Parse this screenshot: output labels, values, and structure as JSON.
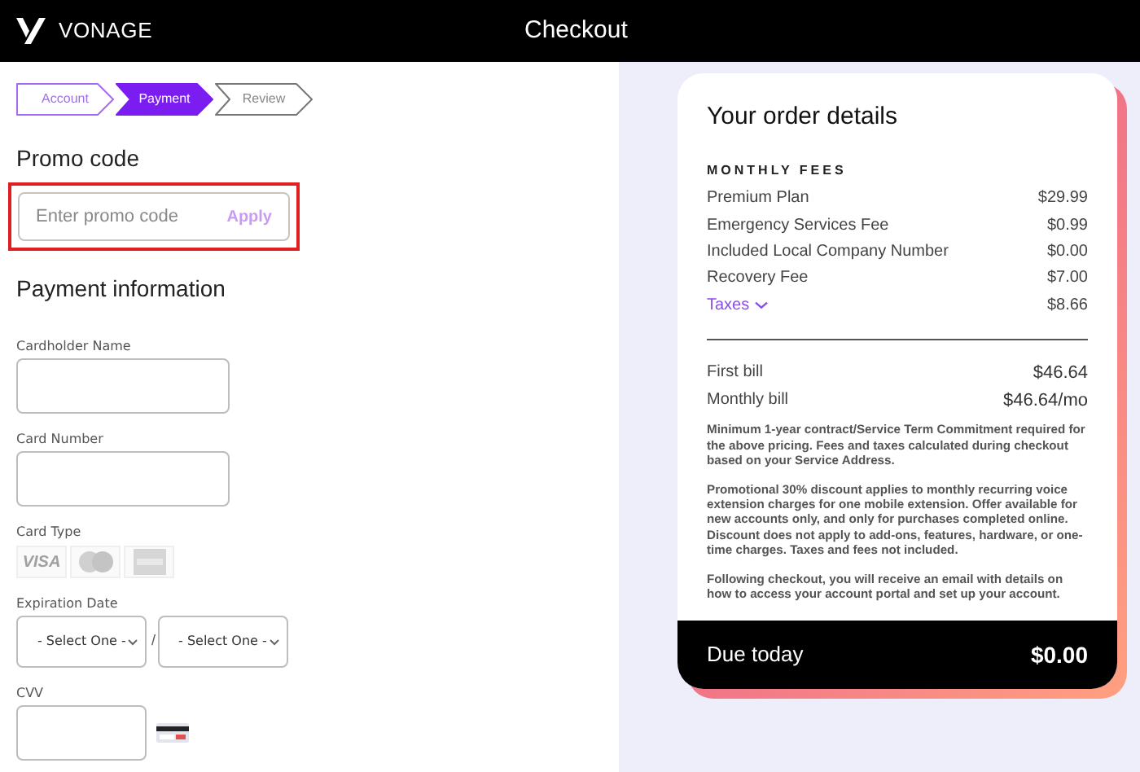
{
  "header": {
    "brand": "VONAGE",
    "title": "Checkout"
  },
  "steps": [
    {
      "label": "Account",
      "selected": false,
      "completed": true
    },
    {
      "label": "Payment",
      "selected": true,
      "completed": false
    },
    {
      "label": "Review",
      "selected": false,
      "completed": false
    }
  ],
  "promo": {
    "heading": "Promo code",
    "placeholder": "Enter promo code",
    "button": "Apply",
    "highlighted": true
  },
  "payment": {
    "heading": "Payment information",
    "fields": [
      {
        "kind": "text",
        "label": "Cardholder Name"
      },
      {
        "kind": "text",
        "label": "Card Number"
      },
      {
        "kind": "cards",
        "label": "Card Type",
        "cards": [
          {
            "kind": "visa",
            "label": "VISA"
          },
          {
            "kind": "mastercard"
          },
          {
            "kind": "amex"
          }
        ]
      },
      {
        "kind": "date",
        "label": "Expiration Date",
        "selects": [
          "- Select One -",
          "- Select One -"
        ],
        "separator": "/"
      },
      {
        "kind": "cvv",
        "label": "CVV"
      }
    ]
  },
  "order": {
    "title": "Your order details",
    "section": "MONTHLY FEES",
    "fees": [
      {
        "label": "Premium Plan",
        "amount": "$29.99",
        "expandable": false
      },
      {
        "label": "Emergency Services Fee",
        "amount": "$0.99",
        "expandable": false
      },
      {
        "label": "Included Local Company Number",
        "amount": "$0.00",
        "expandable": false
      },
      {
        "label": "Recovery Fee",
        "amount": "$7.00",
        "expandable": false
      },
      {
        "label": "Taxes",
        "amount": "$8.66",
        "expandable": true
      }
    ],
    "totals": [
      {
        "label": "First bill",
        "amount": "$46.64"
      },
      {
        "label": "Monthly bill",
        "amount": "$46.64/mo"
      }
    ],
    "notes": [
      "Minimum 1-year contract/Service Term Commitment required for the above pricing. Fees and taxes calculated during checkout based on your Service Address.",
      "Promotional 30% discount applies to monthly recurring voice extension charges for one mobile extension. Offer available for new accounts only, and only for purchases completed online. Discount does not apply to add-ons, features, hardware, or one-time charges. Taxes and fees not included.",
      "Following checkout, you will receive an email with details on how to access your account portal and set up your account."
    ],
    "due": {
      "label": "Due today",
      "amount": "$0.00"
    }
  }
}
